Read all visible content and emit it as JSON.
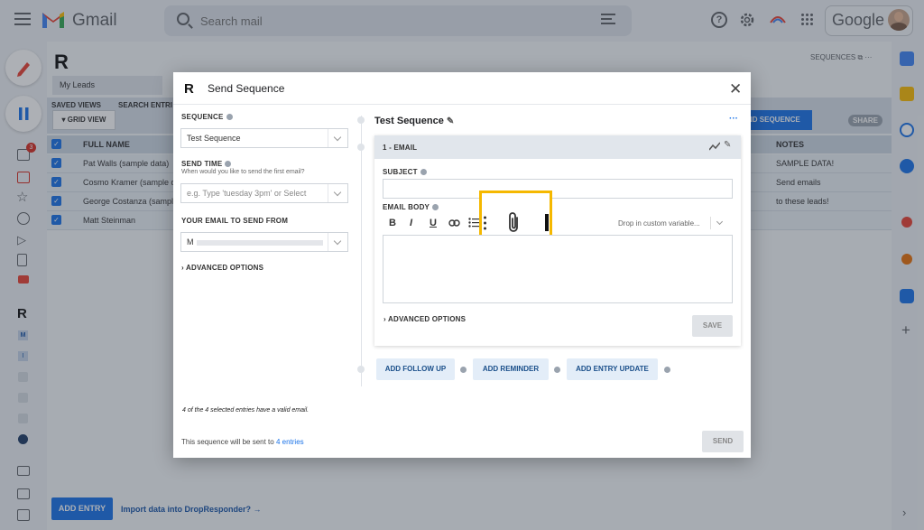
{
  "gmail": {
    "logo_text": "Gmail",
    "search_placeholder": "Search mail",
    "google_text": "Google",
    "help_glyph": "?",
    "inbox_badge": "3"
  },
  "dropresponder": {
    "sequences_link": "SEQUENCES",
    "tab_label": "My Leads",
    "saved_views_label": "SAVED VIEWS",
    "grid_view_label": "GRID VIEW",
    "search_entries_label": "SEARCH ENTRI",
    "send_sequence_label": "ND SEQUENCE",
    "share_label": "SHARE",
    "full_name_header": "FULL NAME",
    "notes_header": "NOTES",
    "rows": [
      {
        "name": "Pat Walls (sample data)",
        "note": "SAMPLE DATA!"
      },
      {
        "name": "Cosmo Kramer (sample da",
        "note": "Send emails"
      },
      {
        "name": "George Costanza (sample",
        "note": "to these leads!"
      },
      {
        "name": "Matt Steinman",
        "note": ""
      }
    ],
    "add_entry_label": "ADD ENTRY",
    "import_link": "Import data into DropResponder? →"
  },
  "modal": {
    "title": "Send Sequence",
    "sequence_label": "SEQUENCE",
    "sequence_value": "Test Sequence",
    "send_time_label": "SEND TIME",
    "send_time_hint": "When would you like to send the first email?",
    "send_time_placeholder": "e.g. Type 'tuesday 3pm' or Select",
    "your_email_label": "YOUR EMAIL TO SEND FROM",
    "your_email_value": "M",
    "advanced_options_left": "ADVANCED OPTIONS",
    "valid_email_note": "4 of the 4 selected entries have a valid email.",
    "sent_to_prefix": "This sequence will be sent to",
    "sent_to_link": "4 entries",
    "send_button": "SEND",
    "sequence_title": "Test Sequence",
    "more_glyph": "···",
    "email_step_label": "1 - EMAIL",
    "subject_label": "SUBJECT",
    "email_body_label": "EMAIL BODY",
    "toolbar": {
      "bold": "B",
      "italic": "I",
      "underline": "U"
    },
    "custom_variable_placeholder": "Drop in custom variable...",
    "advanced_options_card": "ADVANCED OPTIONS",
    "save_button": "SAVE",
    "add_follow_up": "ADD FOLLOW UP",
    "add_reminder": "ADD REMINDER",
    "add_entry_update": "ADD ENTRY UPDATE"
  },
  "colors": {
    "accent": "#1a73e8",
    "highlight": "#f5b800",
    "gmail_red": "#ea4335"
  }
}
